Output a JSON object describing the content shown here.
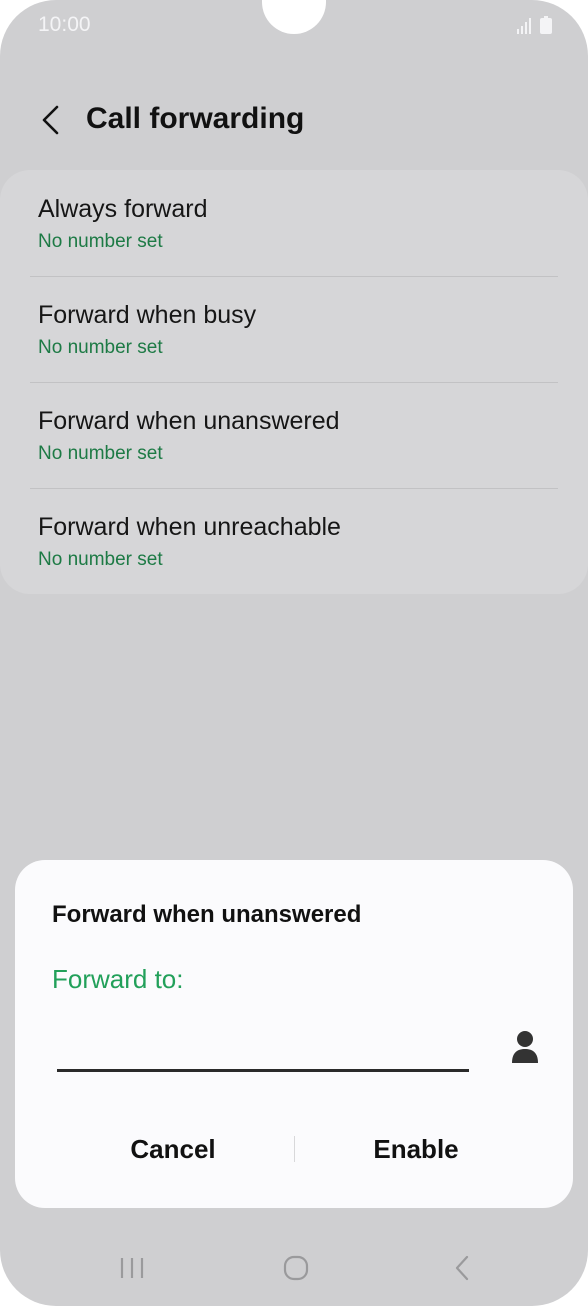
{
  "status_bar": {
    "time": "10:00",
    "icons": [
      "signal-icon",
      "battery-icon"
    ]
  },
  "header": {
    "title": "Call forwarding",
    "back_icon": "chevron-left-icon"
  },
  "settings": {
    "items": [
      {
        "title": "Always forward",
        "subtitle": "No number set"
      },
      {
        "title": "Forward when busy",
        "subtitle": "No number set"
      },
      {
        "title": "Forward when unanswered",
        "subtitle": "No number set"
      },
      {
        "title": "Forward when unreachable",
        "subtitle": "No number set"
      }
    ]
  },
  "dialog": {
    "title": "Forward when unanswered",
    "field_label": "Forward to:",
    "input_value": "",
    "contact_icon": "person-icon",
    "cancel_label": "Cancel",
    "enable_label": "Enable"
  },
  "nav_bar": {
    "icons": [
      "recents-icon",
      "home-icon",
      "back-icon"
    ]
  },
  "colors": {
    "accent_green": "#22a05a",
    "subtitle_green": "#1d7a45",
    "background": "#cfcfd1",
    "dialog_background": "#fbfbfd"
  }
}
